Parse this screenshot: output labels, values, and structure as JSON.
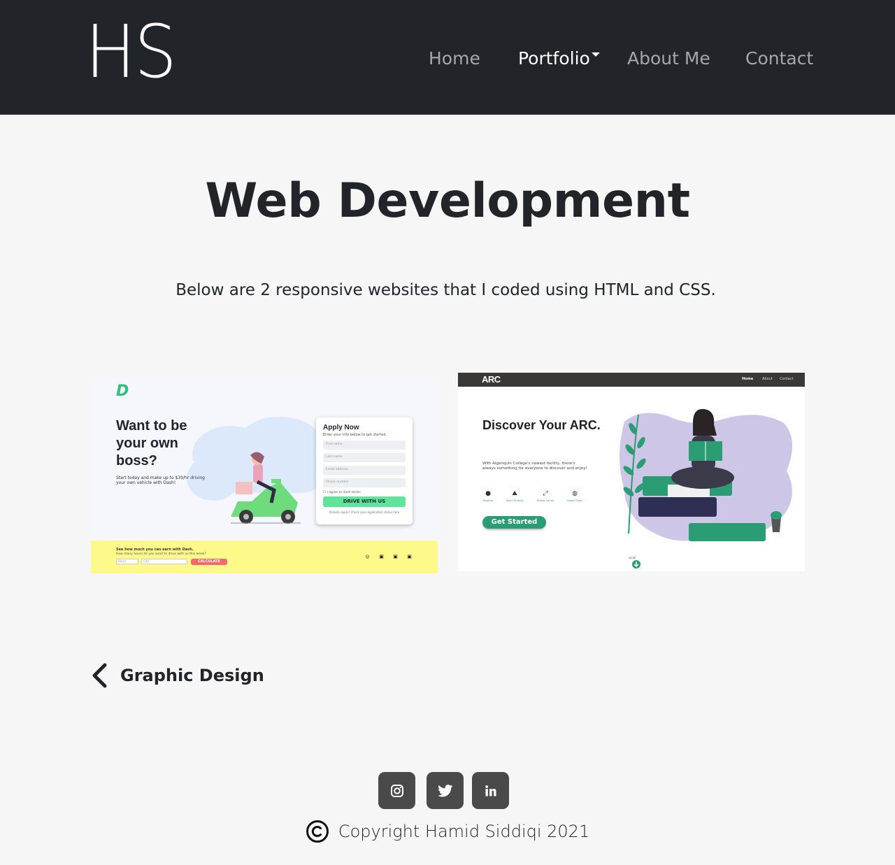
{
  "nav": {
    "logo": "HS",
    "links": [
      {
        "label": "Home"
      },
      {
        "label": "Portfolio"
      },
      {
        "label": "About Me"
      },
      {
        "label": "Contact"
      }
    ]
  },
  "main": {
    "title": "Web Development",
    "description": "Below are 2 responsive websites that I coded using HTML and CSS."
  },
  "projects": {
    "dash": {
      "logo": "D",
      "heading": "Want to be your own boss?",
      "subtext": "Start today and make up to $30/hr driving your own vehicle with Dash!",
      "form_title": "Apply Now",
      "form_subtitle": "Enter your info below to get started.",
      "fields": [
        "First name",
        "Last name",
        "Email address",
        "Phone number"
      ],
      "checkbox": "I agree to dash terms",
      "button": "DRIVE WITH US",
      "note": "Already apply? Check your application status here",
      "footer_title": "See how much you can earn with Dash.",
      "footer_sub": "How many hours do you want to drive with us this week?",
      "footer_input1": "Hours",
      "footer_input2": "City",
      "calculate": "CALCULATE",
      "colors": {
        "accent": "#5ee59a",
        "footer": "#fdfa8a",
        "calc": "#f26b6b"
      }
    },
    "arc": {
      "logo": "ARC",
      "nav": [
        "Home",
        "About",
        "Contact"
      ],
      "heading": "Discover Your ARC.",
      "paragraph": "With Algonquin College's newest facility, there's always something for everyone to discover and enjoy!",
      "features": [
        "Bowling",
        "Rock Climbing",
        "Fitness Center",
        "Indoor Court"
      ],
      "button": "Get Started",
      "scroll": "scroll",
      "colors": {
        "accent": "#2a9d74",
        "blob": "#cdc6e6"
      }
    }
  },
  "back_link": {
    "label": "Graphic Design",
    "icon": "chevron-left-icon"
  },
  "footer": {
    "social": [
      "instagram-icon",
      "twitter-icon",
      "linkedin-icon"
    ],
    "copyright": "Copyright Hamid Siddiqi 2021"
  },
  "colors": {
    "navbar": "#212529",
    "page_bg": "#f6f6f6",
    "social_bg": "#4a4a4a"
  }
}
